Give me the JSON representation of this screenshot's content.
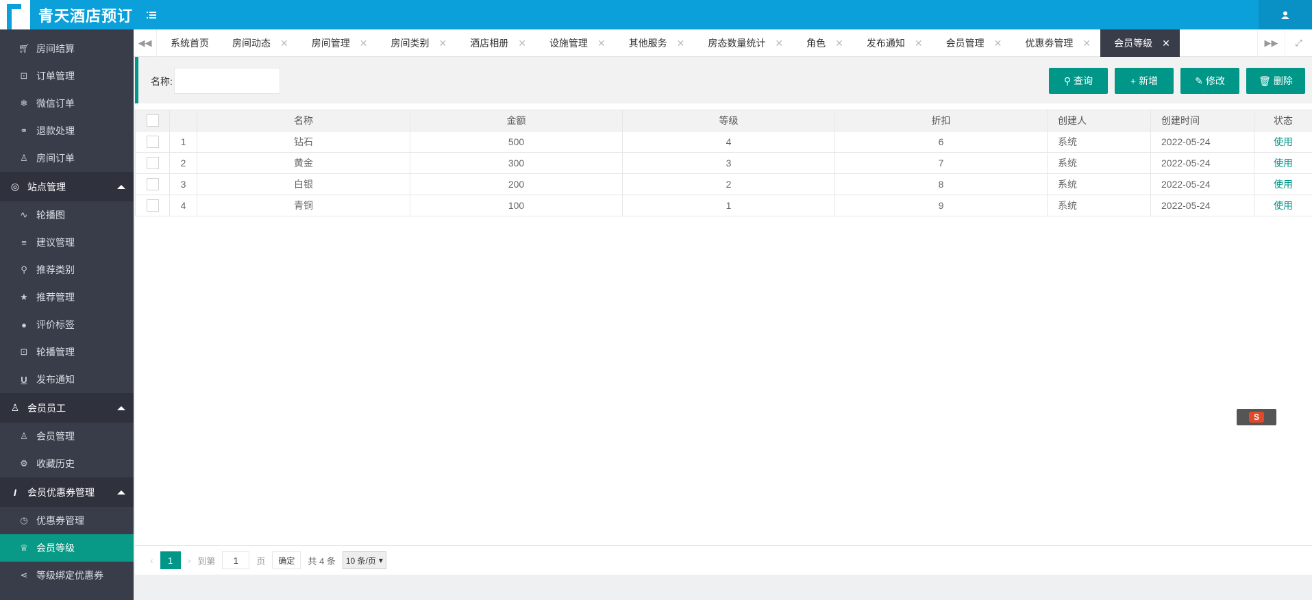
{
  "app": {
    "title": "青天酒店预订"
  },
  "sidebar": {
    "items_top": [
      {
        "label": "房间结算",
        "icon": "cart-icon"
      },
      {
        "label": "订单管理",
        "icon": "lock-icon"
      },
      {
        "label": "微信订单",
        "icon": "snowflake-icon"
      },
      {
        "label": "退款处理",
        "icon": "link-icon"
      },
      {
        "label": "房间订单",
        "icon": "user-icon"
      }
    ],
    "group_site": {
      "label": "站点管理"
    },
    "items_site": [
      {
        "label": "轮播图",
        "icon": "pulse-icon"
      },
      {
        "label": "建议管理",
        "icon": "align-icon"
      },
      {
        "label": "推荐类别",
        "icon": "search-icon"
      },
      {
        "label": "推荐管理",
        "icon": "star-icon"
      },
      {
        "label": "评价标签",
        "icon": "chat-icon"
      },
      {
        "label": "轮播管理",
        "icon": "lock-icon"
      },
      {
        "label": "发布通知",
        "icon": "underline-icon"
      }
    ],
    "group_member": {
      "label": "会员员工"
    },
    "items_member": [
      {
        "label": "会员管理",
        "icon": "users-icon"
      },
      {
        "label": "收藏历史",
        "icon": "gear-icon"
      }
    ],
    "group_coupon": {
      "label": "会员优惠券管理"
    },
    "items_coupon": [
      {
        "label": "优惠券管理",
        "icon": "clock-icon"
      },
      {
        "label": "会员等级",
        "icon": "diamond-icon"
      },
      {
        "label": "等级绑定优惠券",
        "icon": "share-icon"
      }
    ]
  },
  "tabs": [
    "系统首页",
    "房间动态",
    "房间管理",
    "房间类别",
    "酒店相册",
    "设施管理",
    "其他服务",
    "房态数量统计",
    "角色",
    "发布通知",
    "会员管理",
    "优惠劵管理",
    "会员等级"
  ],
  "search": {
    "label": "名称:",
    "value": ""
  },
  "toolbar": {
    "query": "查询",
    "add": "新增",
    "edit": "修改",
    "delete": "删除"
  },
  "table": {
    "headers": [
      "名称",
      "金额",
      "等级",
      "折扣",
      "创建人",
      "创建时间",
      "状态"
    ],
    "rows": [
      {
        "no": "1",
        "name": "钻石",
        "amount": "500",
        "level": "4",
        "discount": "6",
        "creator": "系统",
        "time": "2022-05-24",
        "status": "使用"
      },
      {
        "no": "2",
        "name": "黄金",
        "amount": "300",
        "level": "3",
        "discount": "7",
        "creator": "系统",
        "time": "2022-05-24",
        "status": "使用"
      },
      {
        "no": "3",
        "name": "白银",
        "amount": "200",
        "level": "2",
        "discount": "8",
        "creator": "系统",
        "time": "2022-05-24",
        "status": "使用"
      },
      {
        "no": "4",
        "name": "青铜",
        "amount": "100",
        "level": "1",
        "discount": "9",
        "creator": "系统",
        "time": "2022-05-24",
        "status": "使用"
      }
    ]
  },
  "pager": {
    "current": "1",
    "goto_label": "到第",
    "goto_value": "1",
    "page_unit": "页",
    "confirm": "确定",
    "total": "共 4 条",
    "page_size": "10 条/页"
  },
  "colors": {
    "header": "#0ba0d9",
    "sidebar": "#393d49",
    "accent": "#009688"
  }
}
